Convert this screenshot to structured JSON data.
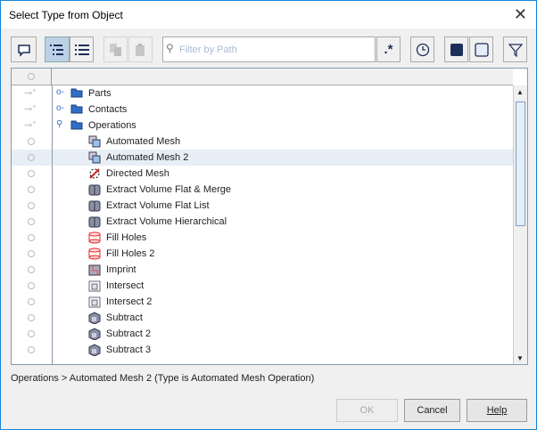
{
  "title": "Select Type from Object",
  "toolbar": {
    "filter_placeholder": "Filter by Path",
    "regex_label": ".*"
  },
  "tree": {
    "rows": [
      {
        "label": "Parts",
        "kind": "folder",
        "level": 0
      },
      {
        "label": "Contacts",
        "kind": "folder",
        "level": 0
      },
      {
        "label": "Operations",
        "kind": "folder",
        "level": 0,
        "expanded": true
      },
      {
        "label": "Automated Mesh",
        "kind": "mesh",
        "level": 1
      },
      {
        "label": "Automated Mesh 2",
        "kind": "mesh",
        "level": 1,
        "selected": true
      },
      {
        "label": "Directed Mesh",
        "kind": "directed",
        "level": 1
      },
      {
        "label": "Extract Volume Flat & Merge",
        "kind": "extract",
        "level": 1
      },
      {
        "label": "Extract Volume Flat List",
        "kind": "extract",
        "level": 1
      },
      {
        "label": "Extract Volume Hierarchical",
        "kind": "extract",
        "level": 1
      },
      {
        "label": "Fill Holes",
        "kind": "fill",
        "level": 1
      },
      {
        "label": "Fill Holes 2",
        "kind": "fill",
        "level": 1
      },
      {
        "label": "Imprint",
        "kind": "imprint",
        "level": 1
      },
      {
        "label": "Intersect",
        "kind": "intersect",
        "level": 1
      },
      {
        "label": "Intersect 2",
        "kind": "intersect",
        "level": 1
      },
      {
        "label": "Subtract",
        "kind": "subtract",
        "level": 1
      },
      {
        "label": "Subtract 2",
        "kind": "subtract",
        "level": 1
      },
      {
        "label": "Subtract 3",
        "kind": "subtract",
        "level": 1
      }
    ]
  },
  "status": "Operations > Automated Mesh 2 (Type is Automated Mesh Operation)",
  "buttons": {
    "ok": "OK",
    "cancel": "Cancel",
    "help": "Help"
  }
}
